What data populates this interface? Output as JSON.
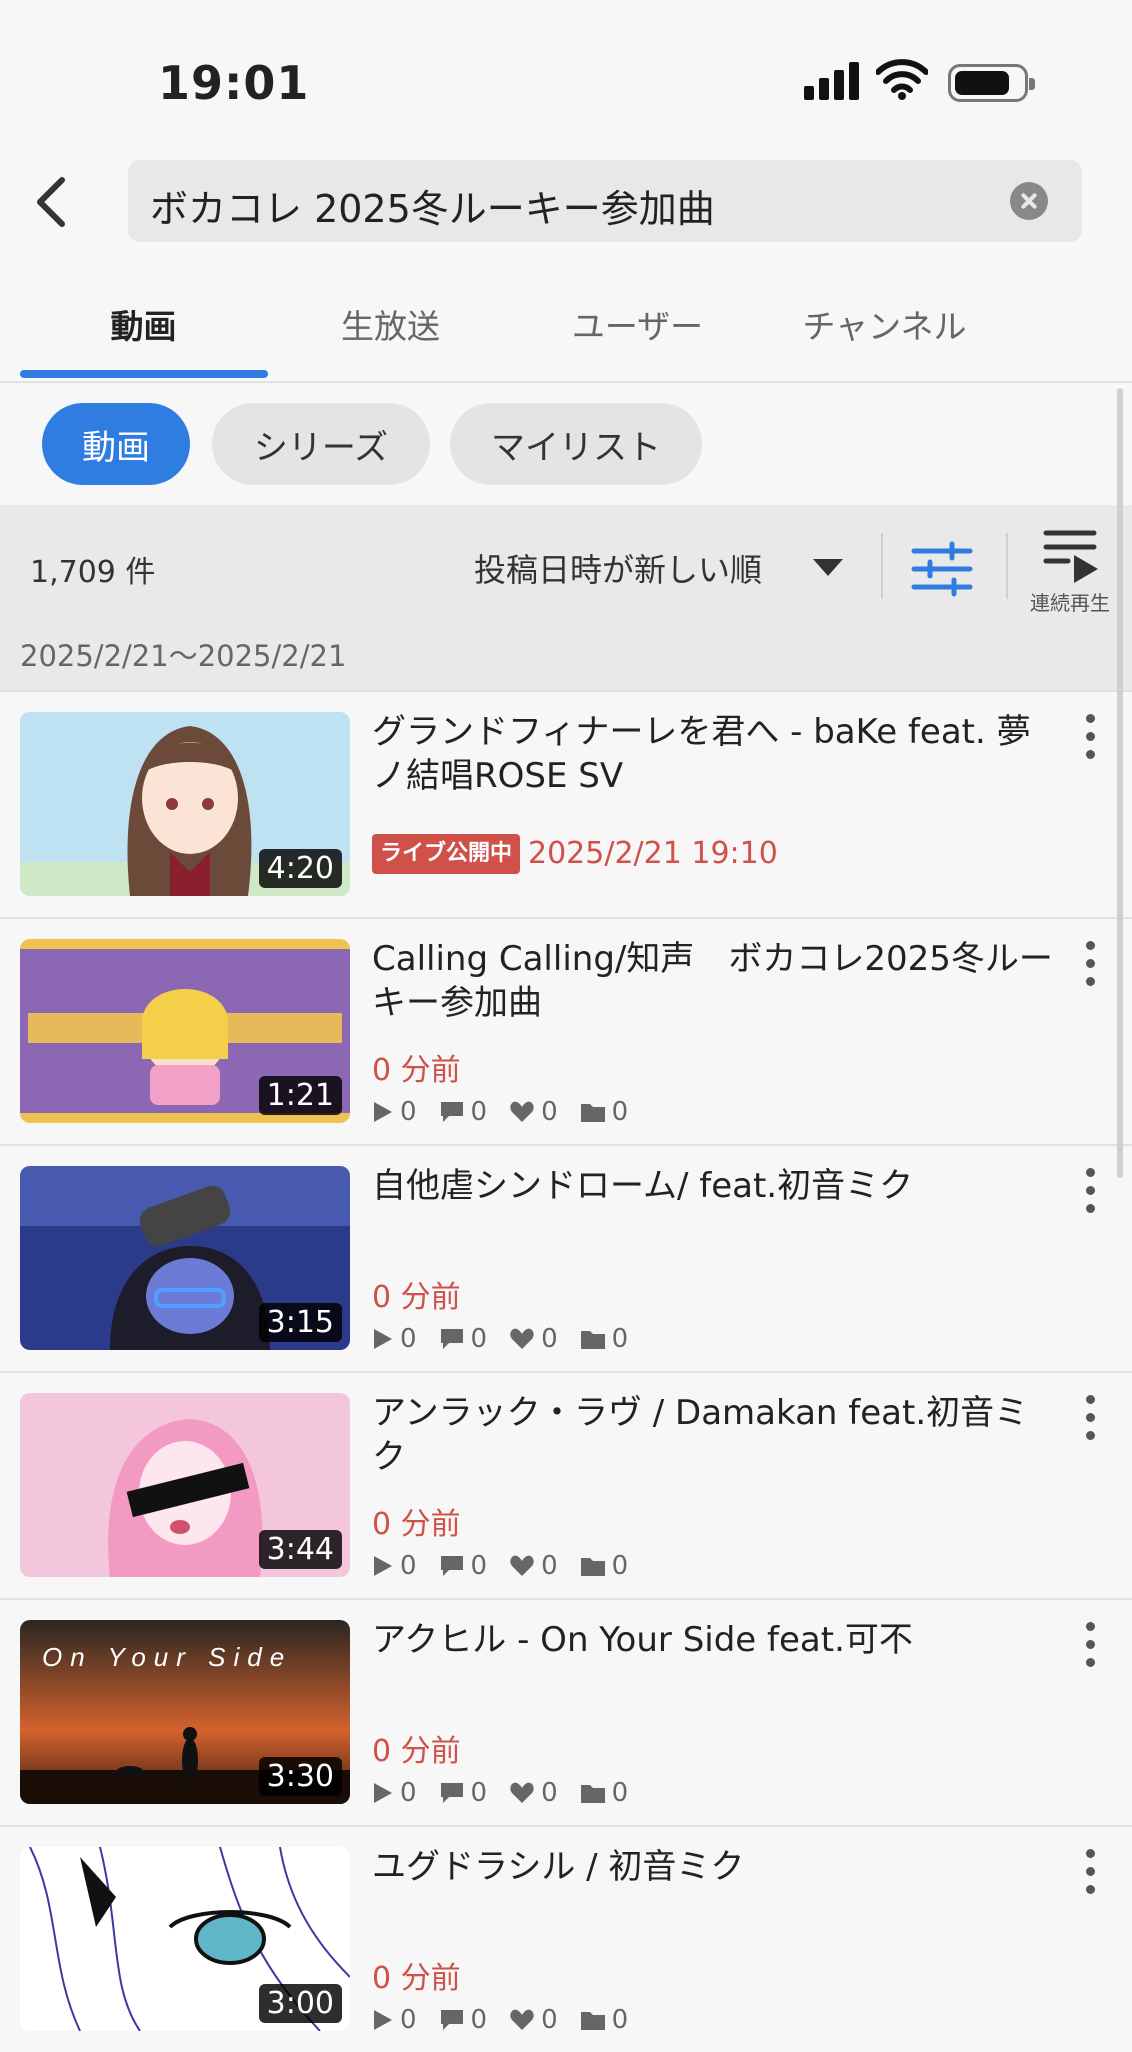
{
  "status": {
    "time": "19:01"
  },
  "search": {
    "query": "ボカコレ 2025冬ルーキー参加曲"
  },
  "tabs": [
    {
      "label": "動画",
      "active": true
    },
    {
      "label": "生放送",
      "active": false
    },
    {
      "label": "ユーザー",
      "active": false
    },
    {
      "label": "チャンネル",
      "active": false
    }
  ],
  "chips": [
    {
      "label": "動画",
      "active": true
    },
    {
      "label": "シリーズ",
      "active": false
    },
    {
      "label": "マイリスト",
      "active": false
    }
  ],
  "toolbar": {
    "count": "1,709 件",
    "sort_label": "投稿日時が新しい順",
    "play_all_label": "連続再生",
    "date_range": "2025/2/21～2025/2/21"
  },
  "colors": {
    "accent": "#2f7de1",
    "warning_red": "#d0504a"
  },
  "videos": [
    {
      "title": "グランドフィナーレを君へ - baKe feat. 夢ノ結唱ROSE SV",
      "duration": "4:20",
      "live_badge": "ライブ公開中",
      "date": "2025/2/21 19:10"
    },
    {
      "title": "Calling Calling/知声　ボカコレ2025冬ルーキー参加曲",
      "duration": "1:21",
      "date": "0 分前",
      "views": "0",
      "comments": "0",
      "likes": "0",
      "mylists": "0"
    },
    {
      "title": "自他虐シンドローム/ feat.初音ミク",
      "duration": "3:15",
      "date": "0 分前",
      "views": "0",
      "comments": "0",
      "likes": "0",
      "mylists": "0"
    },
    {
      "title": "アンラック・ラヴ / Damakan feat.初音ミク",
      "duration": "3:44",
      "date": "0 分前",
      "views": "0",
      "comments": "0",
      "likes": "0",
      "mylists": "0"
    },
    {
      "title": "アクヒル - On Your Side feat.可不",
      "duration": "3:30",
      "date": "0 分前",
      "views": "0",
      "comments": "0",
      "likes": "0",
      "mylists": "0",
      "thumb_text": "On Your Side"
    },
    {
      "title": "ユグドラシル / 初音ミク",
      "duration": "3:00",
      "date": "0 分前",
      "views": "0",
      "comments": "0",
      "likes": "0",
      "mylists": "0"
    }
  ]
}
